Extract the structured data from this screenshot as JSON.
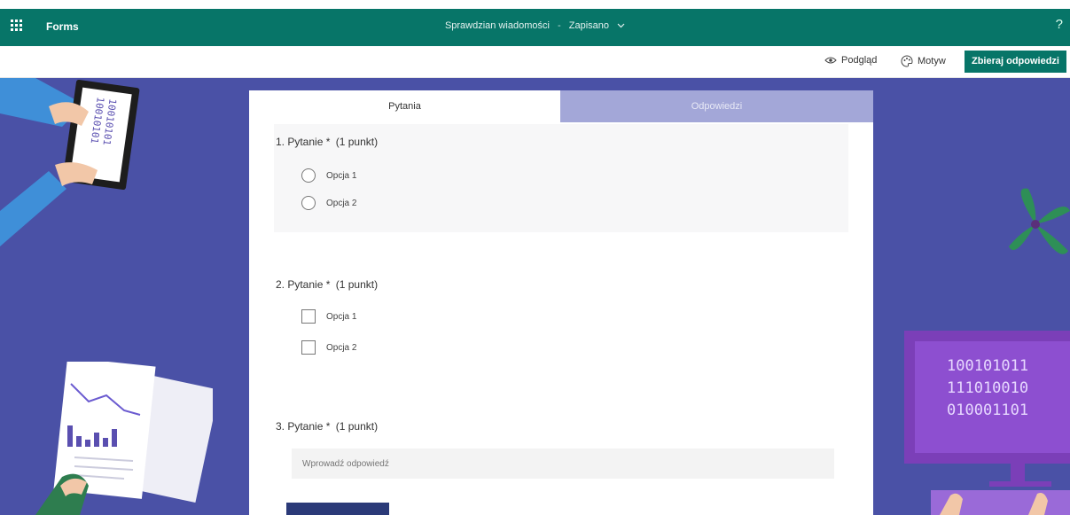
{
  "app": {
    "name": "Forms",
    "help": "?"
  },
  "document": {
    "title": "Sprawdzian wiadomości",
    "sep": "-",
    "status": "Zapisano"
  },
  "toolbar": {
    "preview": "Podgląd",
    "theme": "Motyw",
    "collect": "Zbieraj odpowiedzi"
  },
  "tabs": {
    "questions": "Pytania",
    "responses": "Odpowiedzi"
  },
  "questions": [
    {
      "title": "1. Pytanie",
      "required": "*",
      "points": "(1 punkt)",
      "options": [
        "Opcja 1",
        "Opcja 2"
      ]
    },
    {
      "title": "2. Pytanie",
      "required": "*",
      "points": "(1 punkt)",
      "options": [
        "Opcja 1",
        "Opcja 2"
      ]
    },
    {
      "title": "3. Pytanie",
      "required": "*",
      "points": "(1 punkt)",
      "placeholder": "Wprowadź odpowiedź"
    }
  ],
  "illustrations": {
    "tablet_digits": [
      "10010101",
      "10010101"
    ],
    "monitor_digits": [
      "100101011",
      "111010010",
      "010001101"
    ]
  },
  "colors": {
    "brand": "#077568",
    "background": "#4a51a6",
    "tab_inactive": "#a3a7d8"
  }
}
